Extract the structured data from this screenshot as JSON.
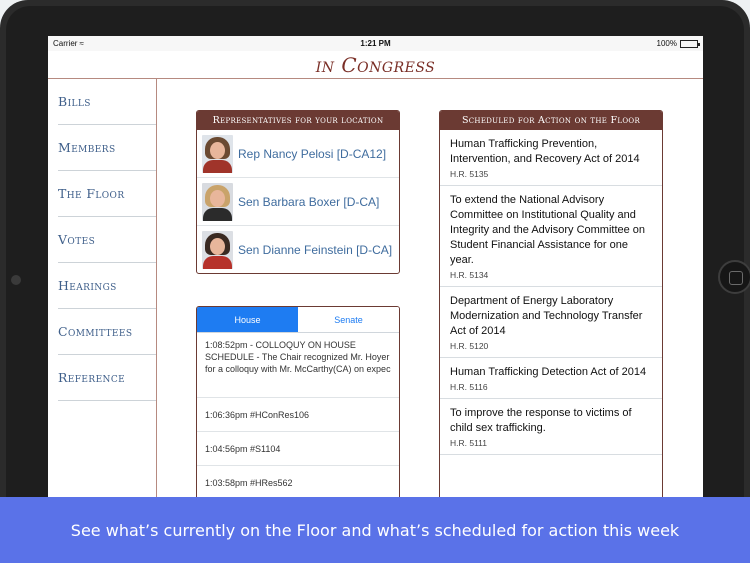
{
  "status_bar": {
    "carrier": "Carrier",
    "time": "1:21 PM",
    "battery": "100%"
  },
  "app": {
    "title": "in Congress"
  },
  "sidebar": {
    "items": [
      {
        "label": "Bills"
      },
      {
        "label": "Members"
      },
      {
        "label": "The Floor"
      },
      {
        "label": "Votes"
      },
      {
        "label": "Hearings"
      },
      {
        "label": "Committees"
      },
      {
        "label": "Reference"
      }
    ]
  },
  "representatives": {
    "header": "Representatives for your location",
    "items": [
      {
        "name": "Rep Nancy Pelosi [D-CA12]",
        "avatar_hair": "#6b4a32",
        "avatar_clothes": "#a0342a"
      },
      {
        "name": "Sen Barbara Boxer [D-CA]",
        "avatar_hair": "#c9a36a",
        "avatar_clothes": "#2b2b2b"
      },
      {
        "name": "Sen Dianne Feinstein [D-CA]",
        "avatar_hair": "#3a2a22",
        "avatar_clothes": "#b6322b"
      }
    ]
  },
  "floor_feed": {
    "tabs": {
      "house": "House",
      "senate": "Senate"
    },
    "items": [
      {
        "text": "1:08:52pm - COLLOQUY ON HOUSE SCHEDULE - The Chair recognized Mr. Hoyer for a colloquy with Mr. McCarthy(CA) on expec"
      },
      {
        "text": "1:06:36pm #HConRes106"
      },
      {
        "text": "1:04:56pm #S1104"
      },
      {
        "text": "1:03:58pm #HRes562"
      }
    ]
  },
  "scheduled": {
    "header": "Scheduled for Action on the Floor",
    "bills": [
      {
        "title": "Human Trafficking Prevention, Intervention, and Recovery Act of 2014",
        "number": "H.R. 5135"
      },
      {
        "title": "To extend the National Advisory Committee on Institutional Quality and Integrity and the Advisory Committee on Student Financial Assistance for one year.",
        "number": "H.R. 5134"
      },
      {
        "title": "Department of Energy Laboratory Modernization and Technology Transfer Act of 2014",
        "number": "H.R. 5120"
      },
      {
        "title": "Human Trafficking Detection Act of 2014",
        "number": "H.R. 5116"
      },
      {
        "title": "To improve the response to victims of child sex trafficking.",
        "number": "H.R. 5111"
      }
    ]
  },
  "banner": {
    "text": "See what’s currently on the Floor and what’s scheduled for action this week"
  },
  "colors": {
    "accent": "#6b3a33",
    "link": "#3f6c9e",
    "tab_active": "#1e7cf2",
    "banner": "#5a72e8"
  }
}
